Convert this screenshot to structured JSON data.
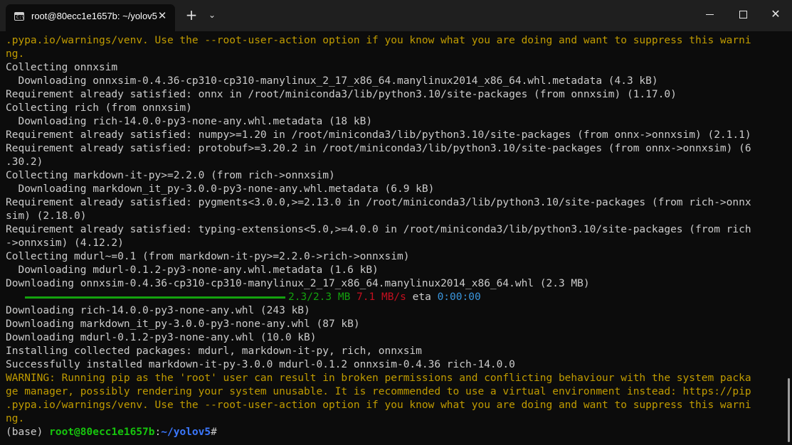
{
  "titlebar": {
    "tab_title": "root@80ecc1e1657b: ~/yolov5",
    "tab_icon_text": "C:\\",
    "close_glyph": "✕",
    "new_tab_glyph": "+",
    "dropdown_glyph": "⌄",
    "win_close_glyph": "✕"
  },
  "terminal": {
    "lines": [
      ".pypa.io/warnings/venv. Use the --root-user-action option if you know what you are doing and want to suppress this warni",
      "ng.",
      "Collecting onnxsim",
      "  Downloading onnxsim-0.4.36-cp310-cp310-manylinux_2_17_x86_64.manylinux2014_x86_64.whl.metadata (4.3 kB)",
      "Requirement already satisfied: onnx in /root/miniconda3/lib/python3.10/site-packages (from onnxsim) (1.17.0)",
      "Collecting rich (from onnxsim)",
      "  Downloading rich-14.0.0-py3-none-any.whl.metadata (18 kB)",
      "Requirement already satisfied: numpy>=1.20 in /root/miniconda3/lib/python3.10/site-packages (from onnx->onnxsim) (2.1.1)",
      "Requirement already satisfied: protobuf>=3.20.2 in /root/miniconda3/lib/python3.10/site-packages (from onnx->onnxsim) (6",
      ".30.2)",
      "Collecting markdown-it-py>=2.2.0 (from rich->onnxsim)",
      "  Downloading markdown_it_py-3.0.0-py3-none-any.whl.metadata (6.9 kB)",
      "Requirement already satisfied: pygments<3.0.0,>=2.13.0 in /root/miniconda3/lib/python3.10/site-packages (from rich->onnx",
      "sim) (2.18.0)",
      "Requirement already satisfied: typing-extensions<5.0,>=4.0.0 in /root/miniconda3/lib/python3.10/site-packages (from rich",
      "->onnxsim) (4.12.2)",
      "Collecting mdurl~=0.1 (from markdown-it-py>=2.2.0->rich->onnxsim)",
      "  Downloading mdurl-0.1.2-py3-none-any.whl.metadata (1.6 kB)",
      "Downloading onnxsim-0.4.36-cp310-cp310-manylinux_2_17_x86_64.manylinux2014_x86_64.whl (2.3 MB)",
      "Downloading rich-14.0.0-py3-none-any.whl (243 kB)",
      "Downloading markdown_it_py-3.0.0-py3-none-any.whl (87 kB)",
      "Downloading mdurl-0.1.2-py3-none-any.whl (10.0 kB)",
      "Installing collected packages: mdurl, markdown-it-py, rich, onnxsim",
      "Successfully installed markdown-it-py-3.0.0 mdurl-0.1.2 onnxsim-0.4.36 rich-14.0.0",
      "WARNING: Running pip as the 'root' user can result in broken permissions and conflicting behaviour with the system packa",
      "ge manager, possibly rendering your system unusable. It is recommended to use a virtual environment instead: https://pip",
      ".pypa.io/warnings/venv. Use the --root-user-action option if you know what you are doing and want to suppress this warni",
      "ng."
    ],
    "progress": {
      "fraction": 1.0,
      "size": "2.3/2.3 MB",
      "speed": "7.1 MB/s",
      "eta_label": "eta",
      "eta": "0:00:00"
    },
    "prompt": {
      "env": "(base) ",
      "host": "root@80ecc1e1657b",
      "colon": ":",
      "path": "~/yolov5",
      "symbol": "#"
    }
  },
  "colors": {
    "background": "#0c0c0c",
    "text": "#cccccc",
    "warning": "#c19c00",
    "progress": "#13a10e",
    "speed": "#c50f1f",
    "eta": "#3a96dd",
    "prompt_host": "#16c60c",
    "prompt_path": "#3b78ff"
  }
}
